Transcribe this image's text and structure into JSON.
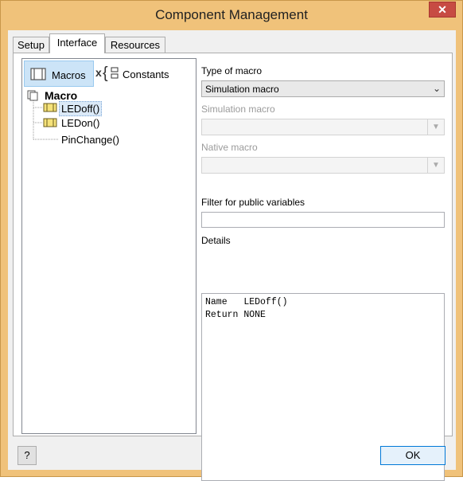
{
  "window": {
    "title": "Component Management",
    "close_label": "✕"
  },
  "tabs": [
    {
      "label": "Setup",
      "active": false
    },
    {
      "label": "Interface",
      "active": true
    },
    {
      "label": "Resources",
      "active": false
    }
  ],
  "left_panel": {
    "macros_tab": "Macros",
    "constants_tab": "Constants",
    "tree": {
      "root": "Macro",
      "items": [
        "LEDoff()",
        "LEDon()",
        "PinChange()"
      ],
      "selected": "LEDoff()"
    }
  },
  "right_panel": {
    "type_of_macro_label": "Type of macro",
    "type_of_macro_value": "Simulation macro",
    "simulation_macro_label": "Simulation macro",
    "simulation_macro_value": "",
    "native_macro_label": "Native macro",
    "native_macro_value": "",
    "filter_label": "Filter for public variables",
    "filter_value": "",
    "details_label": "Details",
    "details": [
      {
        "key": "Name",
        "value": "LEDoff()"
      },
      {
        "key": "Return",
        "value": "NONE"
      }
    ]
  },
  "buttons": {
    "help": "?",
    "ok": "OK"
  }
}
